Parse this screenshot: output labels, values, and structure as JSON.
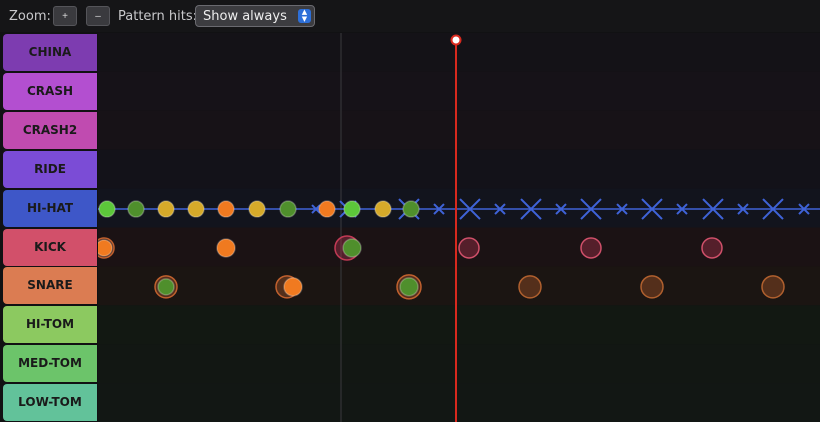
{
  "toolbar": {
    "zoom_label": "Zoom:",
    "zoom_in_label": "+",
    "zoom_out_label": "–",
    "pattern_hits_label": "Pattern hits:",
    "pattern_hits_value": "Show always",
    "select_arrow": "▲▼"
  },
  "lanes": [
    {
      "label": "CHINA",
      "color": "#7d3cb0",
      "bg": "#141217"
    },
    {
      "label": "CRASH",
      "color": "#b34fd0",
      "bg": "#161218"
    },
    {
      "label": "CRASH2",
      "color": "#c04bb0",
      "bg": "#171217"
    },
    {
      "label": "RIDE",
      "color": "#7b4cd6",
      "bg": "#131219"
    },
    {
      "label": "HI-HAT",
      "color": "#3e57c8",
      "bg": "#12141d"
    },
    {
      "label": "KICK",
      "color": "#d2506a",
      "bg": "#1b1214"
    },
    {
      "label": "SNARE",
      "color": "#db7c52",
      "bg": "#1b1512"
    },
    {
      "label": "HI-TOM",
      "color": "#8cc960",
      "bg": "#121812"
    },
    {
      "label": "MED-TOM",
      "color": "#6cc46a",
      "bg": "#121713"
    },
    {
      "label": "LOW-TOM",
      "color": "#62c29a",
      "bg": "#121714"
    }
  ],
  "colors": {
    "playhead": "#d8291e",
    "hit_green": "#5cc73a",
    "hit_darkgreen": "#4f8f2c",
    "hit_yellow": "#d6aa2a",
    "hit_orange": "#f07a20",
    "pattern_blue": "#3f63d8",
    "ghost_red": "#c23a55",
    "ghost_orange": "#c0602e"
  }
}
